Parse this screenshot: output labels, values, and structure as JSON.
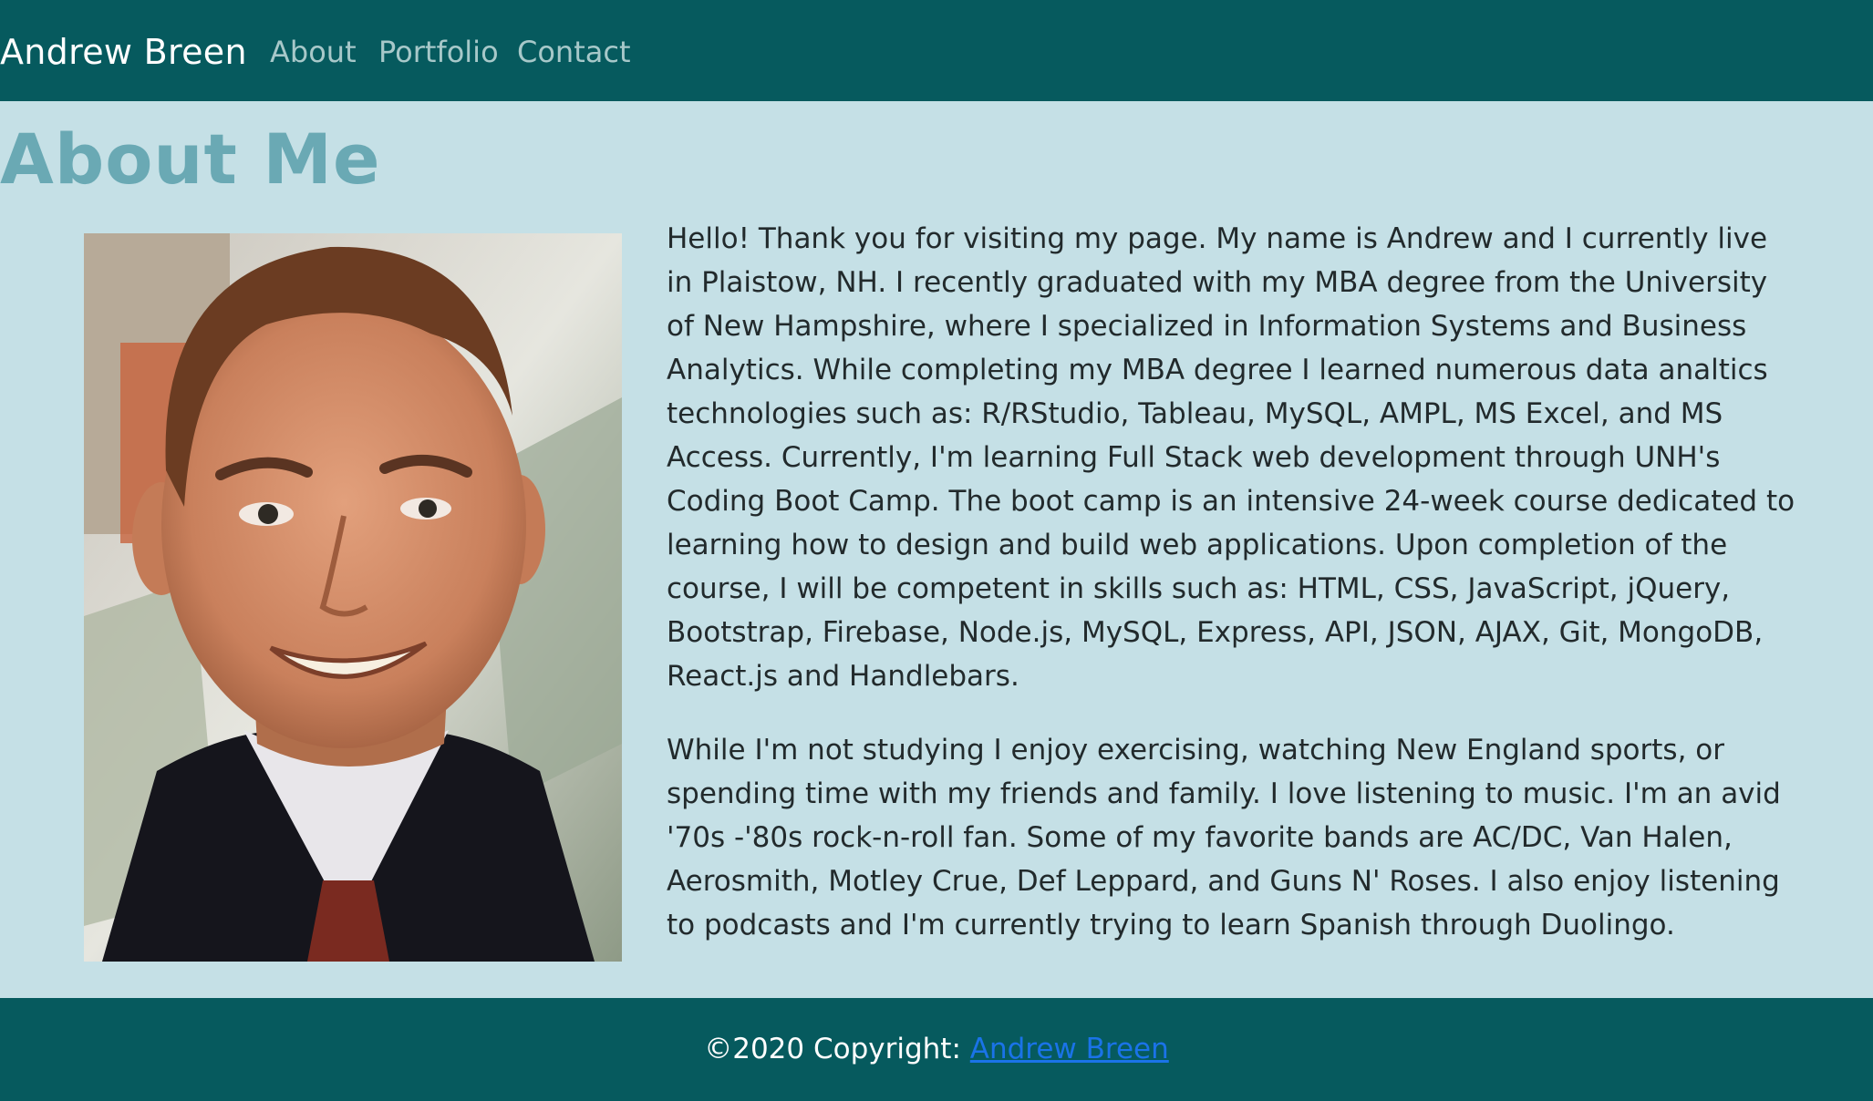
{
  "nav": {
    "brand": "Andrew Breen",
    "links": [
      "About",
      "Portfolio",
      "Contact"
    ]
  },
  "main": {
    "title": "About Me",
    "bio_paragraphs": [
      "Hello! Thank you for visiting my page. My name is Andrew and I currently live in Plaistow, NH. I recently graduated with my MBA degree from the University of New Hampshire, where I specialized in Information Systems and Business Analytics. While completing my MBA degree I learned numerous data analtics technologies such as: R/RStudio, Tableau, MySQL, AMPL, MS Excel, and MS Access. Currently, I'm learning Full Stack web development through UNH's Coding Boot Camp. The boot camp is an intensive 24-week course dedicated to learning how to design and build web applications. Upon completion of the course, I will be competent in skills such as: HTML, CSS, JavaScript, jQuery, Bootstrap, Firebase, Node.js, MySQL, Express, API, JSON, AJAX, Git, MongoDB, React.js and Handlebars.",
      "While I'm not studying I enjoy exercising, watching New England sports, or spending time with my friends and family. I love listening to music. I'm an avid '70s -'80s rock-n-roll fan. Some of my favorite bands are AC/DC, Van Halen, Aerosmith, Motley Crue, Def Leppard, and Guns N' Roses. I also enjoy listening to podcasts and I'm currently trying to learn Spanish through Duolingo."
    ]
  },
  "footer": {
    "copyright_prefix": "©2020 Copyright: ",
    "link_text": "Andrew Breen"
  },
  "colors": {
    "nav_bg": "#065a5e",
    "page_bg": "#c5e0e6",
    "title": "#6aa9b4",
    "nav_link": "#a7c8c9",
    "footer_link": "#1a73e8"
  }
}
